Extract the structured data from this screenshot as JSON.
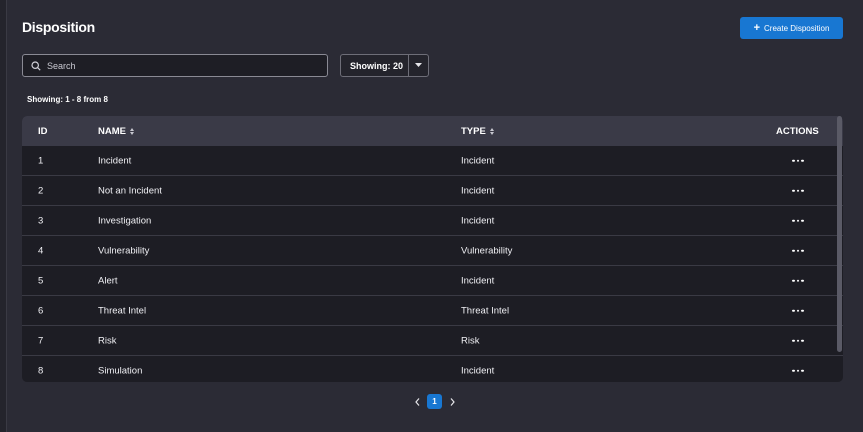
{
  "header": {
    "title": "Disposition",
    "create_button": "Create Disposition"
  },
  "search": {
    "placeholder": "Search",
    "value": ""
  },
  "page_size": {
    "label": "Showing: 20"
  },
  "range_text": "Showing: 1 - 8 from 8",
  "table": {
    "columns": {
      "id": "ID",
      "name": "NAME",
      "type": "TYPE",
      "actions": "ACTIONS"
    },
    "rows": [
      {
        "id": "1",
        "name": "Incident",
        "type": "Incident"
      },
      {
        "id": "2",
        "name": "Not an Incident",
        "type": "Incident"
      },
      {
        "id": "3",
        "name": "Investigation",
        "type": "Incident"
      },
      {
        "id": "4",
        "name": "Vulnerability",
        "type": "Vulnerability"
      },
      {
        "id": "5",
        "name": "Alert",
        "type": "Incident"
      },
      {
        "id": "6",
        "name": "Threat Intel",
        "type": "Threat Intel"
      },
      {
        "id": "7",
        "name": "Risk",
        "type": "Risk"
      },
      {
        "id": "8",
        "name": "Simulation",
        "type": "Incident"
      }
    ]
  },
  "pagination": {
    "current_page": "1"
  },
  "colors": {
    "accent": "#1877d2",
    "background": "#2b2b35",
    "table_bg": "#1d1d24",
    "header_bg": "#3a3a47"
  },
  "icons": [
    "plus-icon",
    "search-icon",
    "chevron-down-icon",
    "sort-icon",
    "more-icon",
    "chevron-left-icon",
    "chevron-right-icon"
  ]
}
